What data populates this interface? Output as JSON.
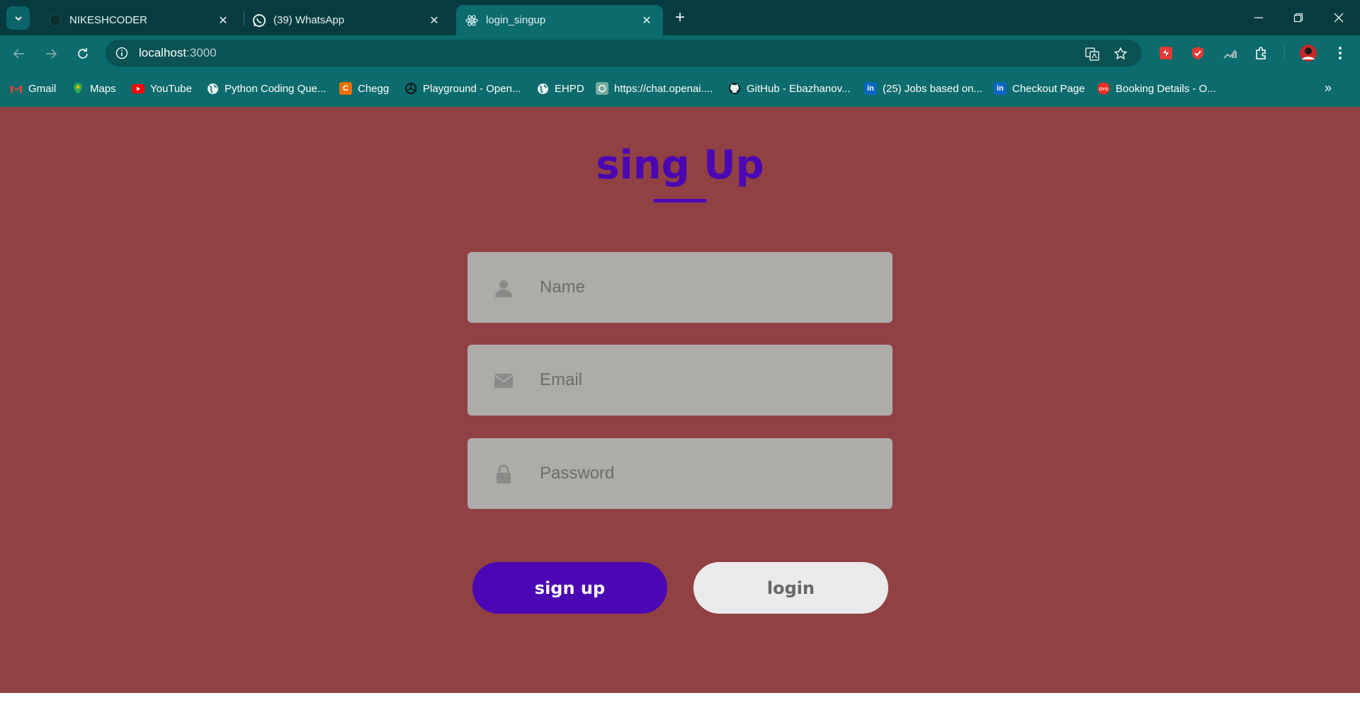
{
  "browser": {
    "tabs": [
      {
        "title": "NIKESHCODER",
        "icon": "github-icon",
        "active": false
      },
      {
        "title": "(39) WhatsApp",
        "icon": "whatsapp-icon",
        "active": false
      },
      {
        "title": "login_singup",
        "icon": "react-icon",
        "active": true
      }
    ],
    "url_host": "localhost",
    "url_port": ":3000",
    "bookmarks": [
      {
        "label": "Gmail",
        "icon": "gmail-icon",
        "color": "#ea4335"
      },
      {
        "label": "Maps",
        "icon": "maps-icon",
        "color": "#34a853"
      },
      {
        "label": "YouTube",
        "icon": "youtube-icon",
        "color": "#ff0000"
      },
      {
        "label": "Python Coding Que...",
        "icon": "globe-icon",
        "color": "#ffffff"
      },
      {
        "label": "Chegg",
        "icon": "chegg-icon",
        "color": "#eb7100"
      },
      {
        "label": "Playground - Open...",
        "icon": "openai-icon",
        "color": "#000000"
      },
      {
        "label": "EHPD",
        "icon": "globe-icon",
        "color": "#ffffff"
      },
      {
        "label": "https://chat.openai....",
        "icon": "chatgpt-icon",
        "color": "#74aa9c"
      },
      {
        "label": "GitHub - Ebazhanov...",
        "icon": "github-icon",
        "color": "#000000"
      },
      {
        "label": "(25) Jobs based on...",
        "icon": "linkedin-icon",
        "color": "#0a66c2"
      },
      {
        "label": "Checkout Page",
        "icon": "linkedin-icon",
        "color": "#0a66c2"
      },
      {
        "label": "Booking Details - O...",
        "icon": "oyo-icon",
        "color": "#ee2e24"
      }
    ]
  },
  "page": {
    "heading": "sing Up",
    "fields": {
      "name_placeholder": "Name",
      "email_placeholder": "Email",
      "password_placeholder": "Password"
    },
    "buttons": {
      "signup": "sign up",
      "login": "login"
    }
  },
  "colors": {
    "background": "#914143",
    "accent": "#4b07b4",
    "field": "#adaca9",
    "login_button": "#eaeaea",
    "chrome": "#0c6b6c"
  }
}
